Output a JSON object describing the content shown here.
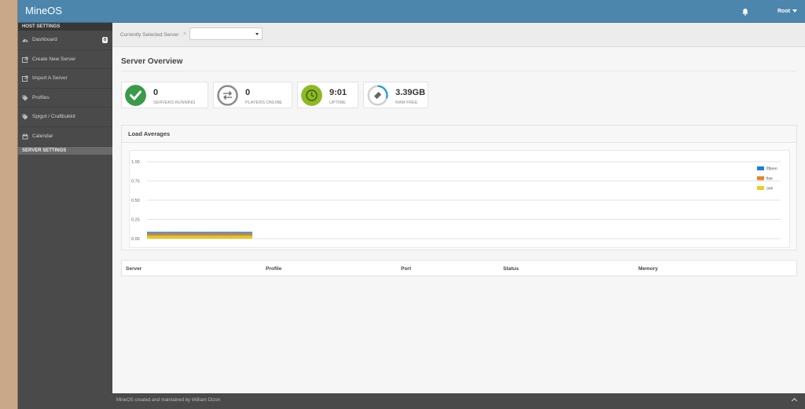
{
  "app": {
    "title": "MineOS"
  },
  "topbar": {
    "user_label": "Root"
  },
  "sidebar": {
    "host_section": "HOST SETTINGS",
    "items": [
      {
        "label": "Dashboard",
        "icon": "dashboard-icon",
        "badge": "0"
      },
      {
        "label": "Create New Server",
        "icon": "external-link-icon"
      },
      {
        "label": "Import A Server",
        "icon": "external-link-icon"
      },
      {
        "label": "Profiles",
        "icon": "tags-icon"
      },
      {
        "label": "Spigot / Craftbukkit",
        "icon": "tags-icon"
      },
      {
        "label": "Calendar",
        "icon": "calendar-icon"
      }
    ],
    "server_section": "SERVER SETTINGS"
  },
  "crumb": {
    "label": "Currently Selected Server",
    "separator": ">"
  },
  "page": {
    "title": "Server Overview"
  },
  "stats": [
    {
      "value": "0",
      "label": "SERVERS RUNNING",
      "icon": "check-icon",
      "color": "#3a9a49"
    },
    {
      "value": "0",
      "label": "PLAYERS ONLINE",
      "icon": "exchange-icon",
      "color": "#888888"
    },
    {
      "value": "9:01",
      "label": "UPTIME",
      "icon": "clock-icon",
      "color": "#8cba23"
    },
    {
      "value": "3.39GB",
      "label": "RAM FREE",
      "icon": "ram-gauge-icon",
      "color": "#2a9fd6",
      "fraction": 0.3
    }
  ],
  "load_panel": {
    "title": "Load Averages"
  },
  "chart_data": {
    "type": "area",
    "title": "",
    "xlabel": "",
    "ylabel": "",
    "ylim": [
      0,
      1
    ],
    "yticks": [
      "1.00",
      "0.75",
      "0.50",
      "0.25",
      "0.00"
    ],
    "legend_position": "top-right",
    "grid": true,
    "series": [
      {
        "name": "fifteen",
        "color": "#1c7fe0",
        "values": [
          0.09,
          0.09,
          0.09,
          0.09,
          0.09
        ]
      },
      {
        "name": "five",
        "color": "#e8821e",
        "values": [
          0.07,
          0.07,
          0.07,
          0.07,
          0.07
        ]
      },
      {
        "name": "one",
        "color": "#e8d020",
        "values": [
          0.04,
          0.04,
          0.04,
          0.04,
          0.04
        ]
      }
    ]
  },
  "table": {
    "columns": [
      "Server",
      "Profile",
      "Port",
      "Status",
      "Memory"
    ]
  },
  "footer": {
    "text": "MineOS created and maintained by William Dizon"
  }
}
